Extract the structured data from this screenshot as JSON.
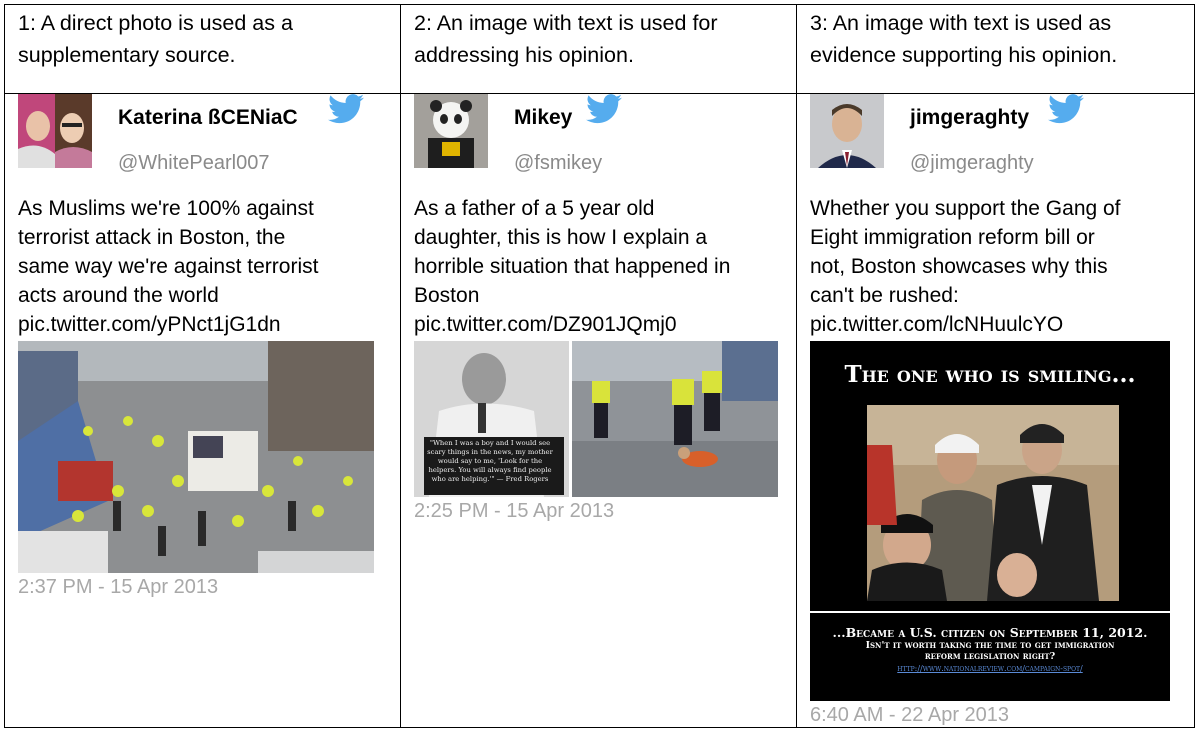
{
  "headers": [
    "1: A direct photo is used as a supplementary source.",
    "2: An image with text is used for addressing his opinion.",
    "3: An image with text is used as evidence supporting his opinion."
  ],
  "tweets": [
    {
      "name": "Katerina ßCENiaC",
      "handle": "@WhitePearl007",
      "text_lines": [
        "As Muslims we're 100% against",
        "terrorist attack in Boston, the",
        "same way we're against terrorist",
        "acts around the world"
      ],
      "link": "pic.twitter.com/yPNct1jG1dn",
      "timestamp": "2:37 PM - 15 Apr 2013"
    },
    {
      "name": "Mikey",
      "handle": "@fsmikey",
      "text_lines": [
        "As a father of a 5 year old",
        "daughter, this is how I explain a",
        "horrible situation that happened in",
        "Boston"
      ],
      "link": "pic.twitter.com/DZ901JQmj0",
      "quote_text": "\"When I was a boy and I would see scary things in the news, my mother would say to me, 'Look for the helpers. You will always find people who are helping.'\" — Fred Rogers",
      "timestamp": "2:25 PM - 15 Apr 2013"
    },
    {
      "name": "jimgeraghty",
      "handle": "@jimgeraghty",
      "text_lines": [
        "Whether you support the Gang of",
        "Eight immigration reform bill or",
        "not, Boston showcases why this",
        "can't be rushed:"
      ],
      "link": "pic.twitter.com/lcNHuulcYO",
      "meme_top": "The one who is smiling...",
      "meme_bottom_1": "...Became a U.S. citizen on September 11, 2012.",
      "meme_bottom_2": "Isn't it worth taking the time to get immigration",
      "meme_bottom_3": "reform legislation right?",
      "meme_url": "http://www.nationalreview.com/campaign-spot/",
      "timestamp": "6:40 AM - 22 Apr 2013"
    }
  ],
  "colors": {
    "twitter_blue": "#55acee",
    "handle_gray": "#8a8a8a",
    "time_gray": "#a8a8a8"
  }
}
